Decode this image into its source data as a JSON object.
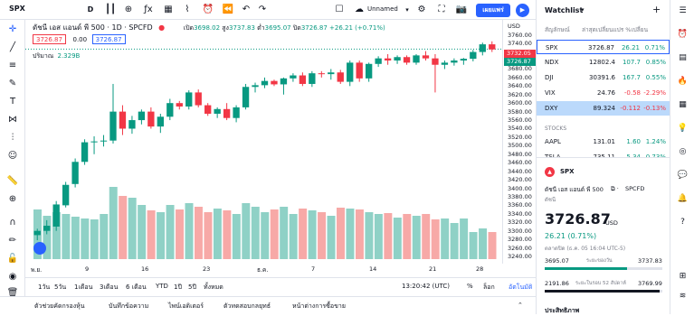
{
  "toolbar": {
    "symbol": "SPX",
    "interval": "D",
    "layout_name": "Unnamed",
    "publish_label": "เผยแพร่"
  },
  "legend": {
    "title": "ดัชนี เอส แอนด์ พี 500 · 1D · SPCFD",
    "open_label": "เปิด",
    "open": "3698.02",
    "high_label": "สูง",
    "high": "3737.83",
    "low_label": "ต่ำ",
    "low": "3695.07",
    "close_label": "ปิด",
    "close": "3726.87",
    "change": "+26.21 (+0.71%)",
    "bid": "3726.87",
    "spread": "0.00",
    "ask": "3726.87",
    "volume_label": "ปริมาณ",
    "volume_value": "2.329B"
  },
  "price_axis": {
    "currency": "USD",
    "ticks": [
      "3760.00",
      "3740.00",
      "3720.00",
      "3700.00",
      "3680.00",
      "3660.00",
      "3640.00",
      "3620.00",
      "3600.00",
      "3580.00",
      "3560.00",
      "3540.00",
      "3520.00",
      "3500.00",
      "3480.00",
      "3460.00",
      "3440.00",
      "3420.00",
      "3400.00",
      "3380.00",
      "3360.00",
      "3340.00",
      "3320.00",
      "3300.00",
      "3280.00",
      "3260.00",
      "3240.00"
    ],
    "last_price_red": "3732.05",
    "last_price_green": "3726.87"
  },
  "time_axis": {
    "ticks": [
      "พ.ย.",
      "9",
      "16",
      "23",
      "ธ.ค.",
      "7",
      "14",
      "21",
      "28"
    ]
  },
  "range_bar": {
    "items": [
      "1วัน",
      "5วัน",
      "1เดือน",
      "3เดือน",
      "6 เดือน",
      "YTD",
      "1ปี",
      "5ปี",
      "ทั้งหมด"
    ],
    "time": "13:20:42 (UTC)",
    "pct": "%",
    "log": "ล็อก",
    "auto": "อัตโนมัติ"
  },
  "bottom_tabs": [
    "ตัวช่วยคัดกรองหุ้น",
    "บันทึกข้อความ",
    "ไพน์เอดิเตอร์",
    "ตัวทดสอบกลยุทธ์",
    "หน้าต่างการซื้อขาย"
  ],
  "watchlist": {
    "title": "Watchlist",
    "col_symbol": "สัญลักษณ์",
    "col_change": "ล่าสุดเปลี่ยนแปร %เปลี่ยน",
    "rows": [
      {
        "symbol": "SPX",
        "last": "3726.87",
        "chg": "26.21",
        "pct": "0.71%",
        "dir": "pos"
      },
      {
        "symbol": "NDX",
        "last": "12802.4",
        "chg": "107.7",
        "pct": "0.85%",
        "dir": "pos"
      },
      {
        "symbol": "DJI",
        "last": "30391.6",
        "chg": "167.7",
        "pct": "0.55%",
        "dir": "pos"
      },
      {
        "symbol": "VIX",
        "last": "24.76",
        "chg": "-0.58",
        "pct": "-2.29%",
        "dir": "neg"
      },
      {
        "symbol": "DXY",
        "last": "89.324",
        "chg": "-0.112",
        "pct": "-0.13%",
        "dir": "neg"
      }
    ],
    "stocks_header": "STOCKS",
    "stock_rows": [
      {
        "symbol": "AAPL",
        "last": "131.01",
        "chg": "1.60",
        "pct": "1.24%",
        "dir": "pos"
      },
      {
        "symbol": "TSLA",
        "last": "735.11",
        "chg": "5.34",
        "pct": "0.73%",
        "dir": "pos"
      }
    ]
  },
  "details": {
    "symbol": "SPX",
    "name": "ดัชนี เอส แอนด์ พี 500",
    "source": "SPCFD",
    "type": "ดัชนี",
    "price": "3726.87",
    "currency": "USD",
    "change": "26.21 (0.71%)",
    "status": "ตลาดปิด (ธ.ค. 05 16:04 UTC-5)",
    "day_low": "3695.07",
    "day_high": "3737.83",
    "day_label": "ระยะของวัน",
    "wk_low": "2191.86",
    "wk_high": "3769.99",
    "wk_label": "ระยะในรอบ 52 สัปดาห์",
    "next_section": "ประสิทธิภาพ"
  },
  "colors": {
    "up": "#089981",
    "down": "#f23645",
    "accent": "#2962ff"
  },
  "chart_data": {
    "type": "candlestick",
    "ylim": [
      3240,
      3770
    ],
    "candles": [
      {
        "o": 3290,
        "h": 3305,
        "l": 3278,
        "c": 3300
      },
      {
        "o": 3300,
        "h": 3325,
        "l": 3292,
        "c": 3312
      },
      {
        "o": 3310,
        "h": 3370,
        "l": 3300,
        "c": 3362
      },
      {
        "o": 3360,
        "h": 3415,
        "l": 3355,
        "c": 3408
      },
      {
        "o": 3410,
        "h": 3470,
        "l": 3402,
        "c": 3462
      },
      {
        "o": 3462,
        "h": 3515,
        "l": 3455,
        "c": 3508
      },
      {
        "o": 3508,
        "h": 3522,
        "l": 3480,
        "c": 3510
      },
      {
        "o": 3510,
        "h": 3525,
        "l": 3498,
        "c": 3512
      },
      {
        "o": 3512,
        "h": 3645,
        "l": 3505,
        "c": 3580
      },
      {
        "o": 3580,
        "h": 3595,
        "l": 3525,
        "c": 3540
      },
      {
        "o": 3540,
        "h": 3570,
        "l": 3528,
        "c": 3560
      },
      {
        "o": 3560,
        "h": 3585,
        "l": 3550,
        "c": 3580
      },
      {
        "o": 3580,
        "h": 3590,
        "l": 3540,
        "c": 3545
      },
      {
        "o": 3545,
        "h": 3575,
        "l": 3530,
        "c": 3568
      },
      {
        "o": 3568,
        "h": 3610,
        "l": 3560,
        "c": 3600
      },
      {
        "o": 3600,
        "h": 3605,
        "l": 3585,
        "c": 3592
      },
      {
        "o": 3592,
        "h": 3630,
        "l": 3585,
        "c": 3625
      },
      {
        "o": 3625,
        "h": 3632,
        "l": 3590,
        "c": 3595
      },
      {
        "o": 3595,
        "h": 3600,
        "l": 3570,
        "c": 3575
      },
      {
        "o": 3575,
        "h": 3590,
        "l": 3565,
        "c": 3586
      },
      {
        "o": 3586,
        "h": 3600,
        "l": 3560,
        "c": 3565
      },
      {
        "o": 3565,
        "h": 3595,
        "l": 3555,
        "c": 3590
      },
      {
        "o": 3590,
        "h": 3645,
        "l": 3585,
        "c": 3638
      },
      {
        "o": 3638,
        "h": 3648,
        "l": 3625,
        "c": 3642
      },
      {
        "o": 3642,
        "h": 3660,
        "l": 3635,
        "c": 3652
      },
      {
        "o": 3652,
        "h": 3655,
        "l": 3640,
        "c": 3644
      },
      {
        "o": 3644,
        "h": 3660,
        "l": 3620,
        "c": 3658
      },
      {
        "o": 3658,
        "h": 3670,
        "l": 3650,
        "c": 3665
      },
      {
        "o": 3665,
        "h": 3672,
        "l": 3640,
        "c": 3645
      },
      {
        "o": 3645,
        "h": 3675,
        "l": 3638,
        "c": 3670
      },
      {
        "o": 3670,
        "h": 3675,
        "l": 3660,
        "c": 3668
      },
      {
        "o": 3668,
        "h": 3680,
        "l": 3655,
        "c": 3672
      },
      {
        "o": 3672,
        "h": 3678,
        "l": 3645,
        "c": 3650
      },
      {
        "o": 3650,
        "h": 3700,
        "l": 3640,
        "c": 3695
      },
      {
        "o": 3695,
        "h": 3700,
        "l": 3650,
        "c": 3658
      },
      {
        "o": 3658,
        "h": 3695,
        "l": 3650,
        "c": 3692
      },
      {
        "o": 3692,
        "h": 3710,
        "l": 3685,
        "c": 3705
      },
      {
        "o": 3705,
        "h": 3715,
        "l": 3690,
        "c": 3700
      },
      {
        "o": 3700,
        "h": 3712,
        "l": 3692,
        "c": 3708
      },
      {
        "o": 3708,
        "h": 3712,
        "l": 3690,
        "c": 3695
      },
      {
        "o": 3695,
        "h": 3715,
        "l": 3690,
        "c": 3712
      },
      {
        "o": 3712,
        "h": 3722,
        "l": 3700,
        "c": 3705
      },
      {
        "o": 3705,
        "h": 3715,
        "l": 3625,
        "c": 3690
      },
      {
        "o": 3690,
        "h": 3700,
        "l": 3680,
        "c": 3695
      },
      {
        "o": 3695,
        "h": 3705,
        "l": 3688,
        "c": 3700
      },
      {
        "o": 3700,
        "h": 3706,
        "l": 3690,
        "c": 3704
      },
      {
        "o": 3704,
        "h": 3725,
        "l": 3698,
        "c": 3720
      },
      {
        "o": 3720,
        "h": 3742,
        "l": 3712,
        "c": 3738
      },
      {
        "o": 3738,
        "h": 3745,
        "l": 3720,
        "c": 3726
      }
    ],
    "volume": [
      55,
      48,
      52,
      50,
      47,
      45,
      44,
      50,
      80,
      70,
      68,
      60,
      54,
      52,
      60,
      55,
      62,
      58,
      52,
      56,
      54,
      50,
      62,
      58,
      52,
      55,
      58,
      50,
      56,
      54,
      52,
      48,
      57,
      56,
      55,
      52,
      50,
      51,
      46,
      50,
      48,
      50,
      44,
      45,
      40,
      45,
      30,
      34,
      30
    ]
  }
}
